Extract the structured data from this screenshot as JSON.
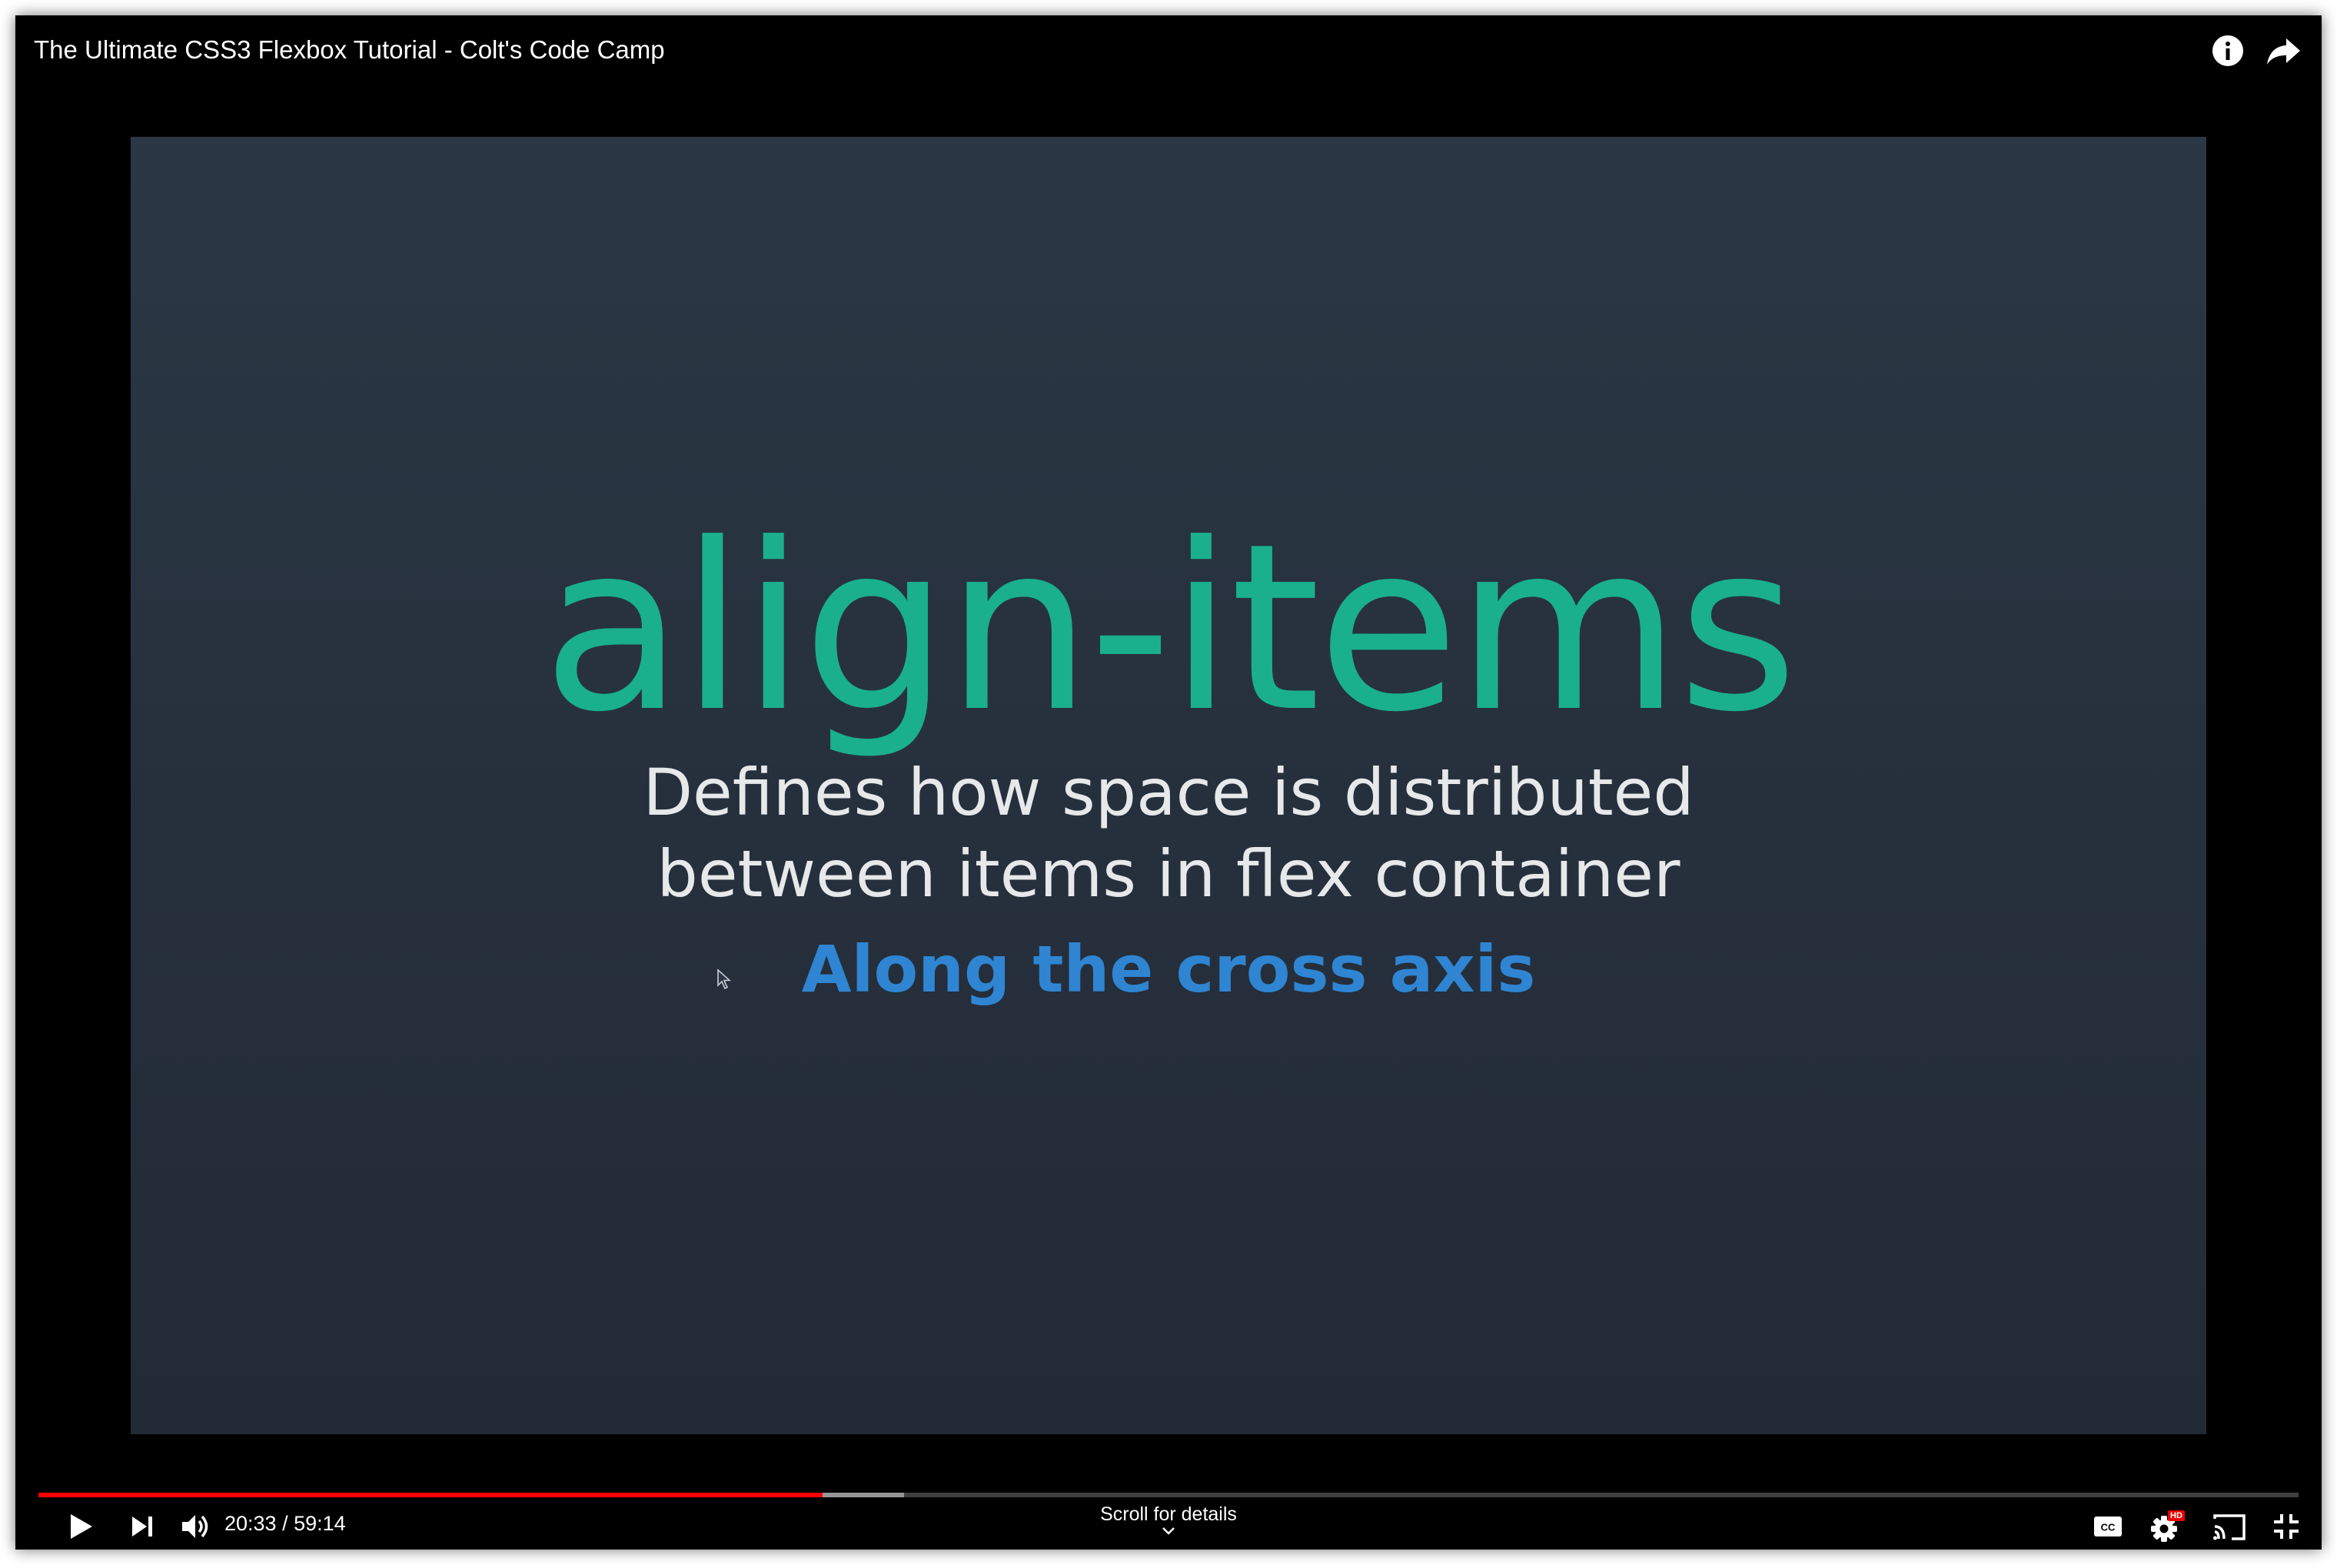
{
  "video": {
    "title": "The Ultimate CSS3 Flexbox Tutorial - Colt's Code Camp"
  },
  "slide": {
    "heading": "align-items",
    "description_lines": [
      "Defines how space is distributed",
      "between items in flex container"
    ],
    "subheading": "Along the cross axis",
    "colors": {
      "heading": "#1ab08d",
      "description": "#e6e8ea",
      "subheading": "#2f85d2",
      "background": "#27313e"
    }
  },
  "controls": {
    "current_time": "20:33",
    "duration": "59:14",
    "time_display": "20:33 / 59:14",
    "progress_fraction": 0.347,
    "buffered_fraction": 0.383,
    "progress_color": "#ff0000",
    "scroll_hint": "Scroll for details",
    "quality_badge": "HD",
    "icons": {
      "top_right": [
        "info-icon",
        "share-icon"
      ],
      "left": [
        "play-icon",
        "next-icon",
        "volume-icon"
      ],
      "right": [
        "subtitles-icon",
        "settings-icon",
        "cast-icon",
        "exit-fullscreen-icon"
      ]
    }
  }
}
